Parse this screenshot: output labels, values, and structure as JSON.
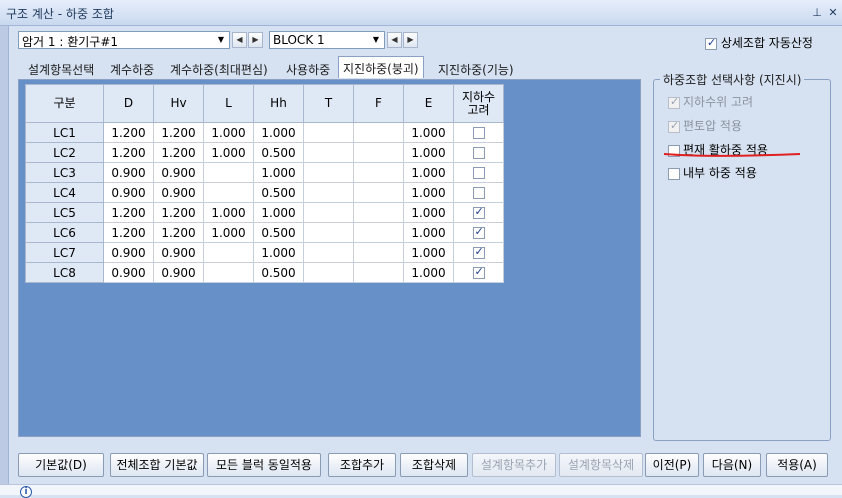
{
  "window": {
    "title": "구조 계산 - 하중 조합",
    "pin_icon": "pin-icon",
    "close_icon": "close-icon"
  },
  "selectors": {
    "culvert": "암거 1 : 환기구#1",
    "block": "BLOCK  1"
  },
  "auto_calc": {
    "label": "상세조합 자동산정",
    "checked": true
  },
  "tabs": [
    "설계항목선택",
    "계수하중",
    "계수하중(최대편심)",
    "사용하중",
    "지진하중(붕괴)",
    "지진하중(기능)"
  ],
  "active_tab": 4,
  "table": {
    "headers": [
      "구분",
      "D",
      "Hv",
      "L",
      "Hh",
      "T",
      "F",
      "E",
      "지하수\n고려"
    ],
    "rows": [
      {
        "name": "LC1",
        "D": "1.200",
        "Hv": "1.200",
        "L": "1.000",
        "Hh": "1.000",
        "T": "",
        "F": "",
        "E": "1.000",
        "gw": false
      },
      {
        "name": "LC2",
        "D": "1.200",
        "Hv": "1.200",
        "L": "1.000",
        "Hh": "0.500",
        "T": "",
        "F": "",
        "E": "1.000",
        "gw": false
      },
      {
        "name": "LC3",
        "D": "0.900",
        "Hv": "0.900",
        "L": "",
        "Hh": "1.000",
        "T": "",
        "F": "",
        "E": "1.000",
        "gw": false
      },
      {
        "name": "LC4",
        "D": "0.900",
        "Hv": "0.900",
        "L": "",
        "Hh": "0.500",
        "T": "",
        "F": "",
        "E": "1.000",
        "gw": false
      },
      {
        "name": "LC5",
        "D": "1.200",
        "Hv": "1.200",
        "L": "1.000",
        "Hh": "1.000",
        "T": "",
        "F": "",
        "E": "1.000",
        "gw": true
      },
      {
        "name": "LC6",
        "D": "1.200",
        "Hv": "1.200",
        "L": "1.000",
        "Hh": "0.500",
        "T": "",
        "F": "",
        "E": "1.000",
        "gw": true
      },
      {
        "name": "LC7",
        "D": "0.900",
        "Hv": "0.900",
        "L": "",
        "Hh": "1.000",
        "T": "",
        "F": "",
        "E": "1.000",
        "gw": true
      },
      {
        "name": "LC8",
        "D": "0.900",
        "Hv": "0.900",
        "L": "",
        "Hh": "0.500",
        "T": "",
        "F": "",
        "E": "1.000",
        "gw": true
      }
    ]
  },
  "options": {
    "title": "하중조합 선택사항 (지진시)",
    "items": [
      {
        "label": "지하수위 고려",
        "checked": true,
        "enabled": false
      },
      {
        "label": "편토압 적용",
        "checked": true,
        "enabled": false
      },
      {
        "label": "편재 활하중 적용",
        "checked": false,
        "enabled": true
      },
      {
        "label": "내부 하중 적용",
        "checked": false,
        "enabled": true
      }
    ]
  },
  "buttons": [
    {
      "label": "기본값(D)",
      "enabled": true
    },
    {
      "label": "전체조합 기본값",
      "enabled": true
    },
    {
      "label": "모든 블럭 동일적용",
      "enabled": true
    },
    {
      "label": "조합추가",
      "enabled": true
    },
    {
      "label": "조합삭제",
      "enabled": true
    },
    {
      "label": "설계항목추가",
      "enabled": false
    },
    {
      "label": "설계항목삭제",
      "enabled": false
    },
    {
      "label": "이전(P)",
      "enabled": true
    },
    {
      "label": "다음(N)",
      "enabled": true
    },
    {
      "label": "적용(A)",
      "enabled": true
    }
  ],
  "colors": {
    "grid_area": "#6890c8",
    "annotation": "#e02020"
  }
}
